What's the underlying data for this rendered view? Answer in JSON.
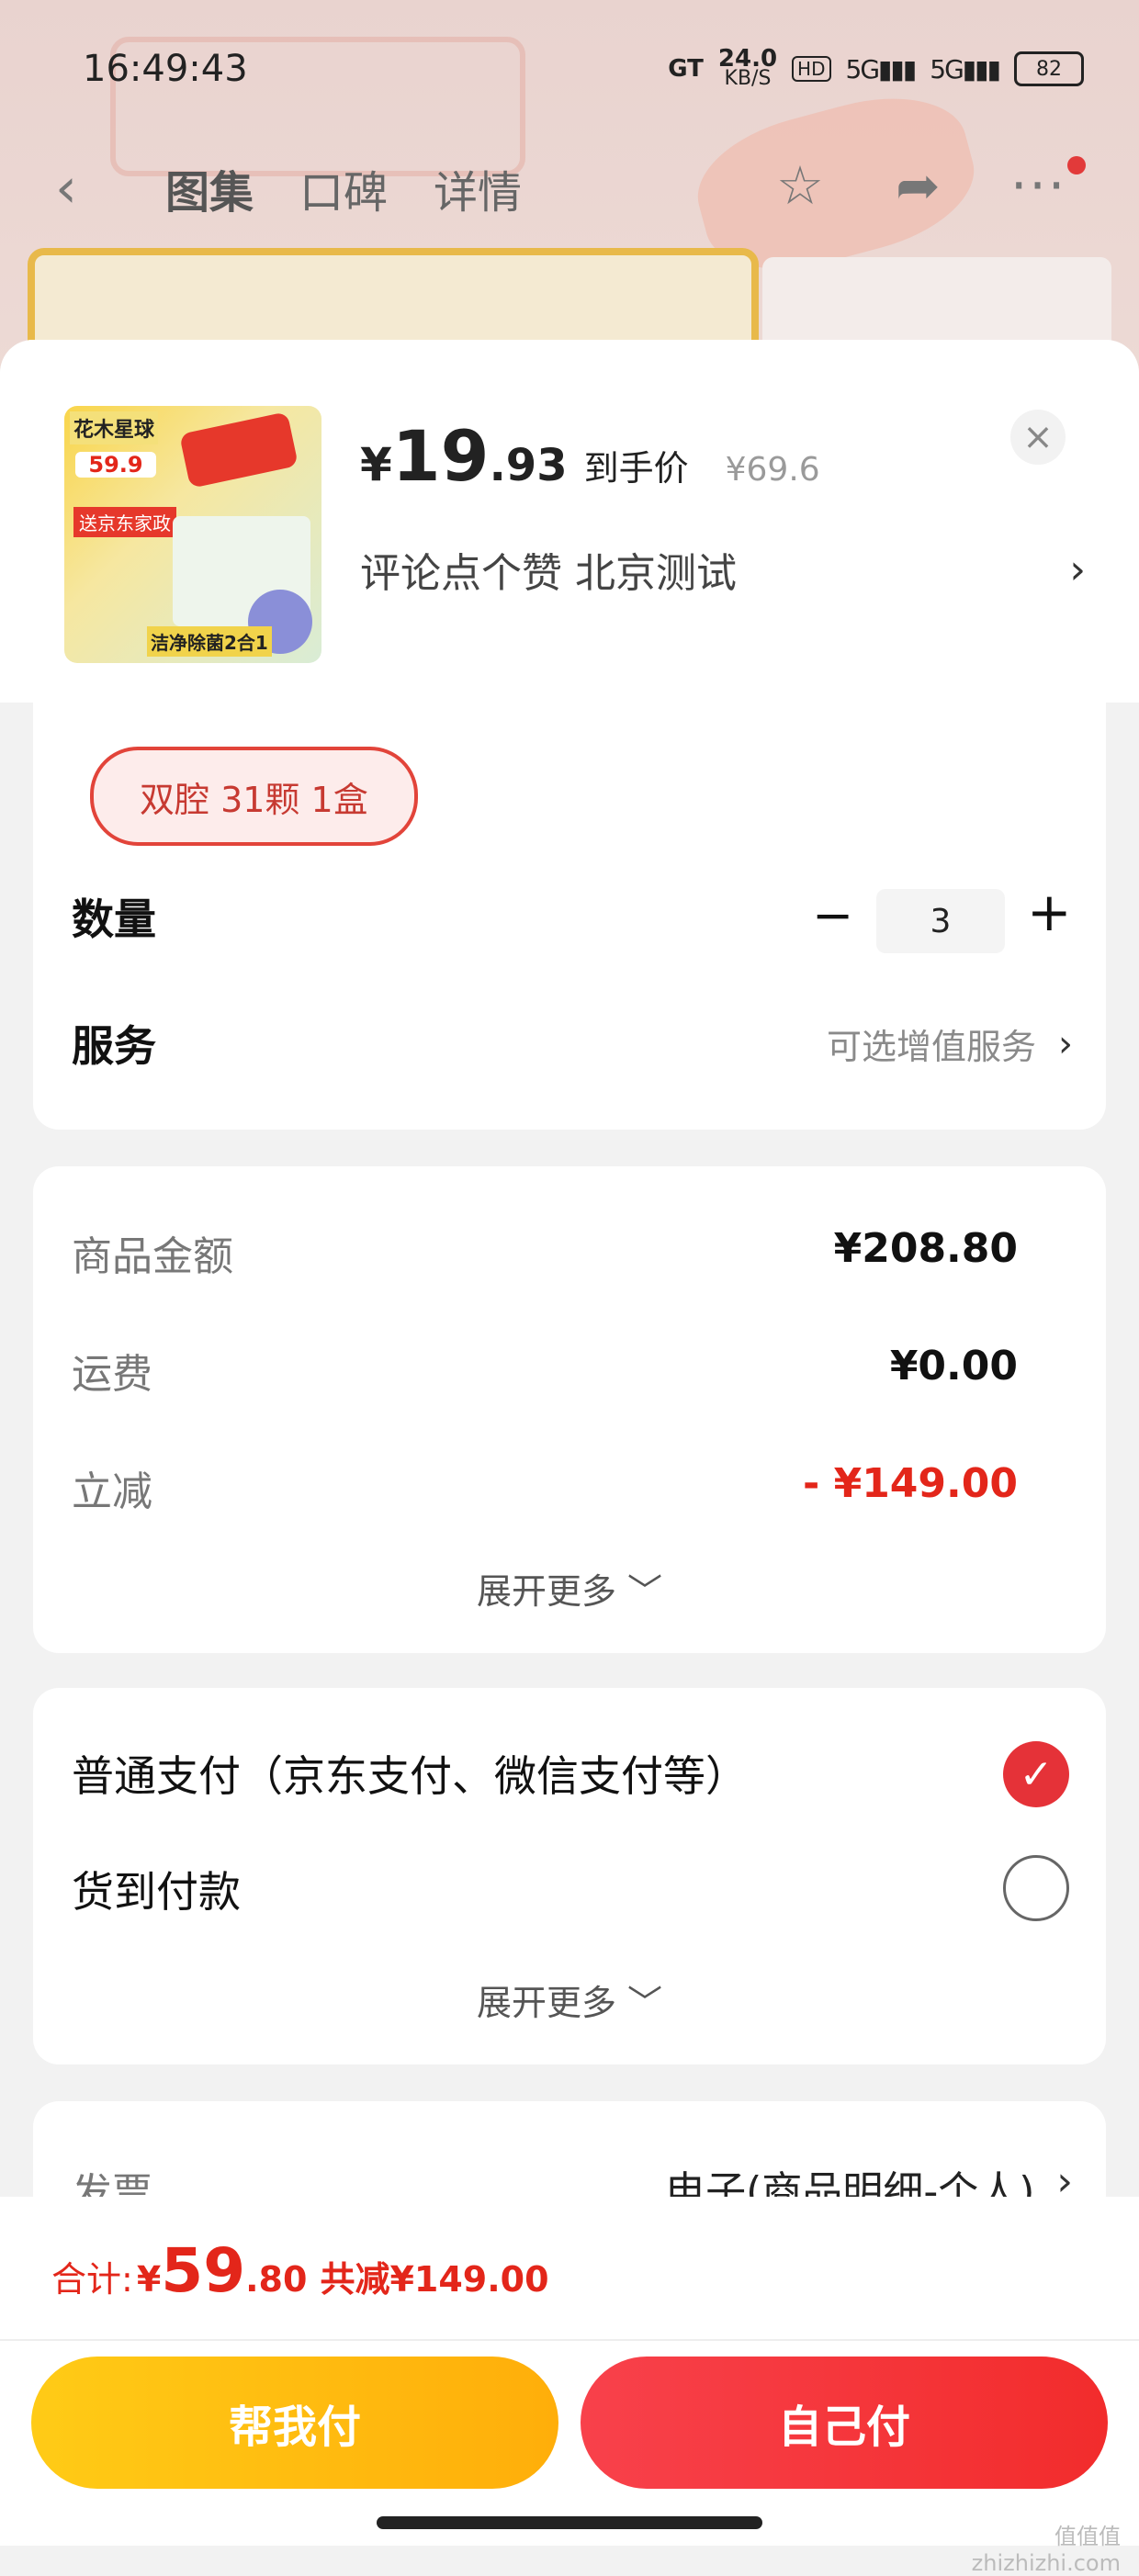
{
  "status_bar": {
    "time": "16:49:43",
    "network_speed": "24.0",
    "network_unit": "KB/S",
    "gt": "GT",
    "hd": "HD",
    "signal1": "5G",
    "signal2": "5G",
    "battery": "82"
  },
  "nav": {
    "tabs": [
      "图集",
      "口碑",
      "详情"
    ],
    "has_notification_dot": true
  },
  "product": {
    "thumb_logo": "花木星球",
    "thumb_price": "59.9",
    "thumb_tag": "送京东家政",
    "thumb_bottom": "洁净除菌2合1",
    "price_symbol": "¥",
    "price_int": "19",
    "price_dec": ".93",
    "price_label": "到手价",
    "original_price": "¥69.6",
    "subtitle": "评论点个赞  北京测试",
    "close": "×"
  },
  "spec": {
    "selected_chip": "双腔 31颗 1盒"
  },
  "quantity": {
    "label": "数量",
    "minus": "−",
    "value": "3",
    "plus": "+"
  },
  "service": {
    "label": "服务",
    "value": "可选增值服务"
  },
  "summary": {
    "lines": [
      {
        "label": "商品金额",
        "value": "¥208.80"
      },
      {
        "label": "运费",
        "value": "¥0.00"
      },
      {
        "label": "立减",
        "value": "- ¥149.00"
      }
    ],
    "expand": "展开更多 ﹀"
  },
  "payment": {
    "options": [
      {
        "label": "普通支付（京东支付、微信支付等）",
        "selected": true
      },
      {
        "label": "货到付款",
        "selected": false
      }
    ],
    "expand": "展开更多 ﹀"
  },
  "invoice": {
    "label": "发票",
    "value": "电子(商品明细-个人)"
  },
  "footer": {
    "total_label": "合计:",
    "total_yen": "¥",
    "total_int": "59",
    "total_dec": ".80",
    "total_saved": "共减¥149.00",
    "help_pay": "帮我付",
    "self_pay": "自己付"
  },
  "watermark": "值值值\nzhizhizhi.com",
  "colors": {
    "accent_red": "#e3261a",
    "pay_red": "#f22c2c",
    "help_yellow": "#ffb60d",
    "chip_border": "#e2443a"
  },
  "icons": {
    "back": "chevron-left-icon",
    "favorite": "star-icon",
    "share": "share-icon",
    "more": "more-icon",
    "close": "close-icon",
    "chevron": "chevron-right-icon",
    "check": "check-icon"
  }
}
